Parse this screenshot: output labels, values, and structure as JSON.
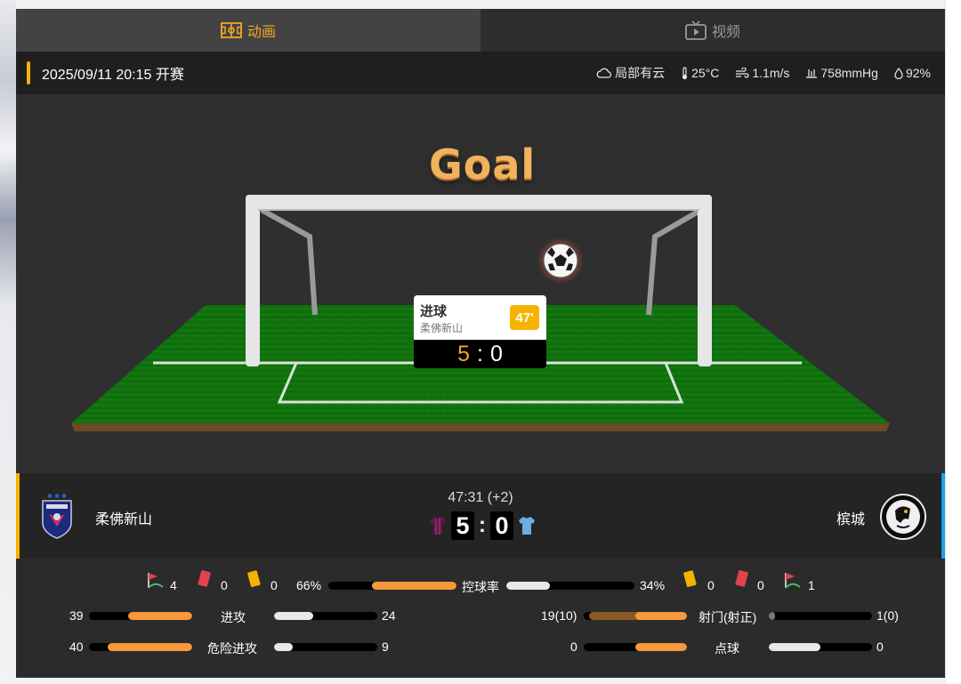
{
  "tabs": {
    "animation": "动画",
    "video": "视频"
  },
  "info": {
    "kickoff": "2025/09/11 20:15 开赛",
    "weather": "局部有云",
    "temperature": "25°C",
    "wind": "1.1m/s",
    "pressure": "758mmHg",
    "humidity": "92%"
  },
  "animation": {
    "banner": "Goal",
    "event": {
      "title": "进球",
      "team": "柔佛新山",
      "minute": "47'",
      "home": "5",
      "sep": ":",
      "away": "0"
    }
  },
  "match": {
    "home_team": "柔佛新山",
    "away_team": "槟城",
    "clock": "47:31 (+2)",
    "home_score": "5",
    "away_score": "0",
    "score_sep": ":"
  },
  "stats": {
    "home": {
      "corners": "4",
      "red": "0",
      "yellow": "0"
    },
    "away": {
      "corners": "1",
      "red": "0",
      "yellow": "0"
    },
    "possession": {
      "label": "控球率",
      "home": "66%",
      "away": "34%",
      "home_value": 66,
      "away_value": 34
    },
    "attacks": {
      "label": "进攻",
      "home": "39",
      "away": "24",
      "home_value": 39,
      "away_value": 24
    },
    "dangerous": {
      "label": "危险进攻",
      "home": "40",
      "away": "9",
      "home_value": 40,
      "away_value": 9
    },
    "shots": {
      "label": "射门(射正)",
      "home": "19(10)",
      "away": "1(0)",
      "home_value": 19,
      "home_on_target": 10,
      "away_value": 1,
      "away_on_target": 0
    },
    "penalties": {
      "label": "点球",
      "home": "0",
      "away": "0",
      "home_value": 0,
      "away_value": 0
    }
  },
  "colors": {
    "home_accent": "#f5b301",
    "away_accent": "#1aa3e8",
    "home_bar": "#f7993a",
    "away_bar": "#e8e8e8",
    "tab_active": "#f5a623"
  }
}
